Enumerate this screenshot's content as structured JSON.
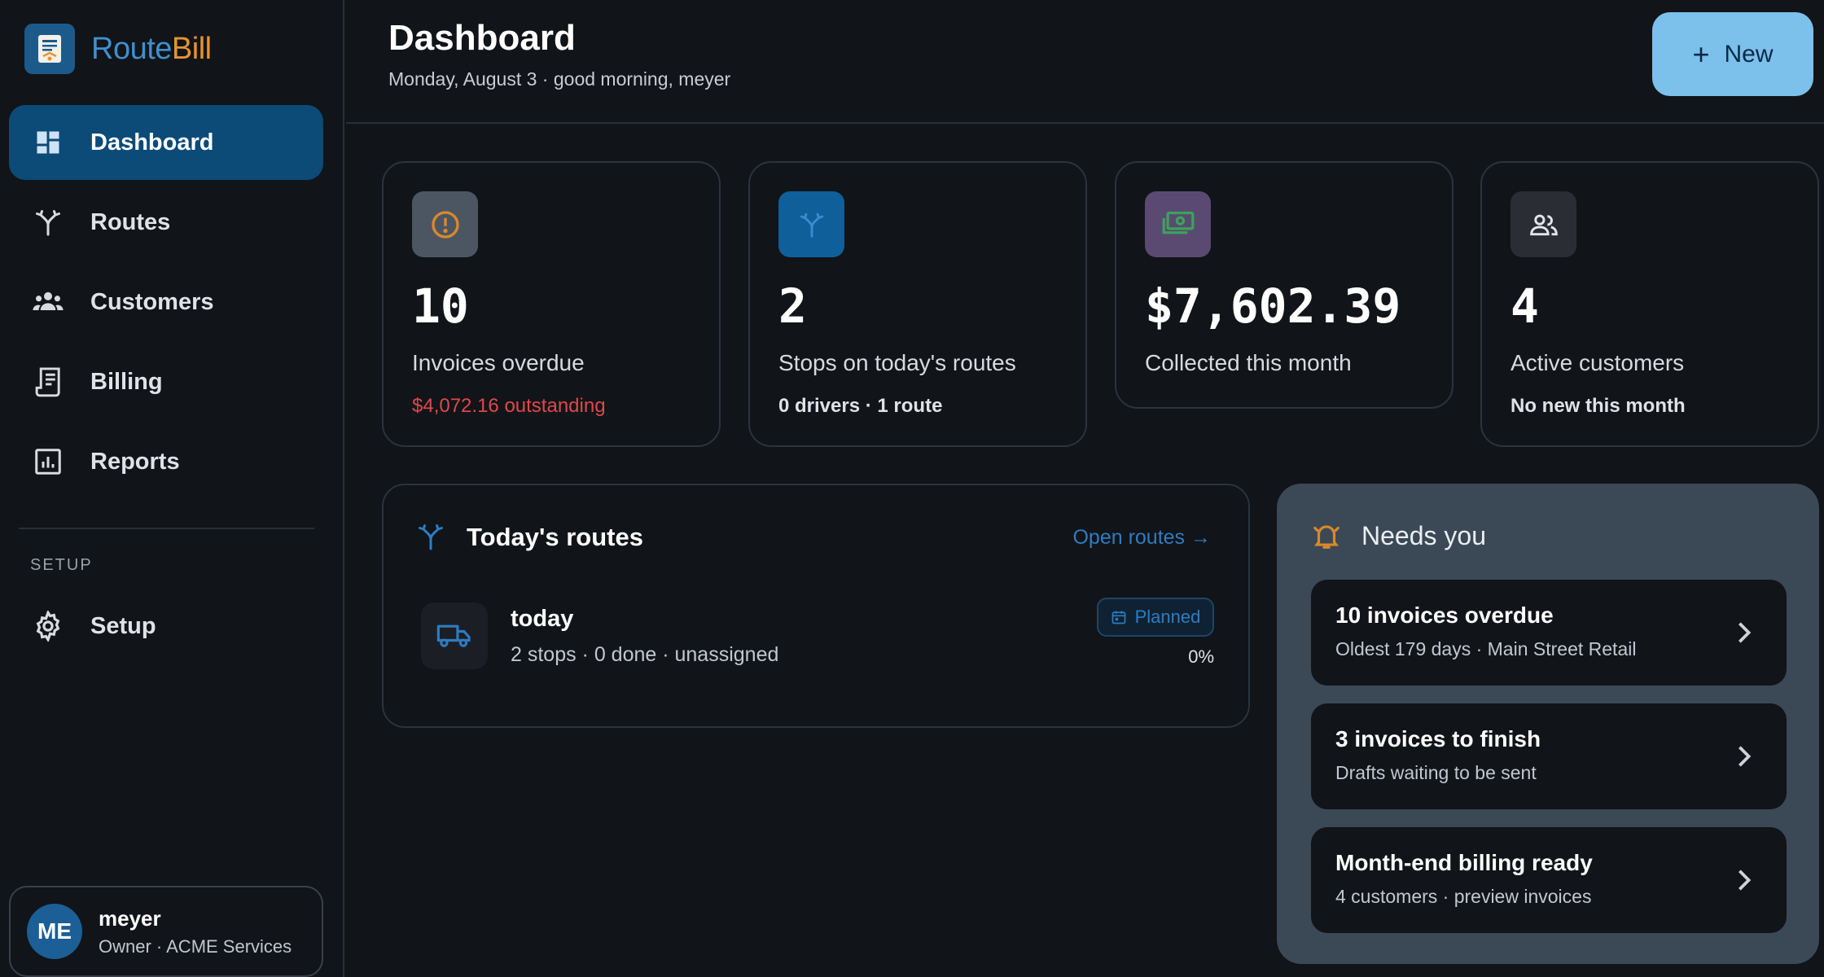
{
  "app": {
    "brand_part1": "Route",
    "brand_part2": "Bill",
    "accent_color": "#0c4a78",
    "button_color": "#7cc0ec"
  },
  "sidebar": {
    "items": [
      {
        "label": "Dashboard",
        "icon": "dashboard-icon",
        "active": true
      },
      {
        "label": "Routes",
        "icon": "routes-icon"
      },
      {
        "label": "Customers",
        "icon": "customers-icon"
      },
      {
        "label": "Billing",
        "icon": "billing-icon"
      },
      {
        "label": "Reports",
        "icon": "reports-icon"
      }
    ],
    "setup_heading": "SETUP",
    "setup_item": {
      "label": "Setup",
      "icon": "gear-icon"
    }
  },
  "user": {
    "initials": "ME",
    "name": "meyer",
    "role": "Owner · ACME Services"
  },
  "header": {
    "title": "Dashboard",
    "subtitle": "Monday, August 3 · good morning, meyer",
    "new_button_label": "New"
  },
  "stats": [
    {
      "value": "10",
      "label": "Invoices overdue",
      "note": "$4,072.16 outstanding",
      "icon": "alert-icon"
    },
    {
      "value": "2",
      "label": "Stops on today's routes",
      "note": "0 drivers · 1 route",
      "icon": "routes-icon"
    },
    {
      "value": "$7,602.39",
      "label": "Collected this month",
      "icon": "money-icon"
    },
    {
      "value": "4",
      "label": "Active customers",
      "note": "No new this month",
      "icon": "users-icon"
    }
  ],
  "routes_panel": {
    "title": "Today's routes",
    "open_link": "Open routes →",
    "route": {
      "name": "today",
      "meta": "2 stops · 0 done · unassigned",
      "status": "Planned",
      "progress": "0%"
    }
  },
  "needs": {
    "title": "Needs you",
    "items": [
      {
        "title": "10 invoices overdue",
        "subtitle": "Oldest 179 days · Main Street Retail"
      },
      {
        "title": "3 invoices to finish",
        "subtitle": "Drafts waiting to be sent"
      },
      {
        "title": "Month-end billing ready",
        "subtitle": "4 customers · preview invoices"
      }
    ]
  }
}
